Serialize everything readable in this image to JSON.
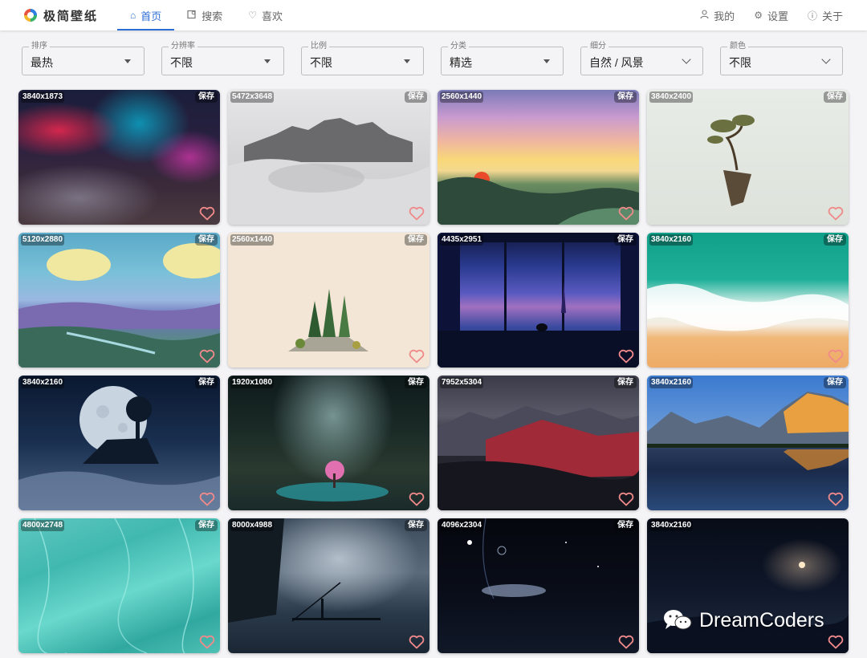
{
  "app": {
    "title": "极简壁纸"
  },
  "nav": {
    "home": "首页",
    "search": "搜索",
    "favorites": "喜欢",
    "mine": "我的",
    "settings": "设置",
    "about": "关于"
  },
  "filters": {
    "sort": {
      "label": "排序",
      "value": "最热"
    },
    "resolution": {
      "label": "分辨率",
      "value": "不限"
    },
    "ratio": {
      "label": "比例",
      "value": "不限"
    },
    "category": {
      "label": "分类",
      "value": "精选"
    },
    "subcategory": {
      "label": "细分",
      "value": "自然 / 风景"
    },
    "color": {
      "label": "颜色",
      "value": "不限"
    }
  },
  "save_label": "保存",
  "wallpapers": [
    {
      "resolution": "3840x1873"
    },
    {
      "resolution": "5472x3648"
    },
    {
      "resolution": "2560x1440"
    },
    {
      "resolution": "3840x2400"
    },
    {
      "resolution": "5120x2880"
    },
    {
      "resolution": "2560x1440"
    },
    {
      "resolution": "4435x2951"
    },
    {
      "resolution": "3840x2160"
    },
    {
      "resolution": "3840x2160"
    },
    {
      "resolution": "1920x1080"
    },
    {
      "resolution": "7952x5304"
    },
    {
      "resolution": "3840x2160"
    },
    {
      "resolution": "4800x2748"
    },
    {
      "resolution": "8000x4988"
    },
    {
      "resolution": "4096x2304"
    },
    {
      "resolution": "3840x2160"
    }
  ],
  "watermark": "DreamCoders",
  "colors": {
    "accent": "#2b6fd6",
    "heart": "#f08a8a"
  }
}
